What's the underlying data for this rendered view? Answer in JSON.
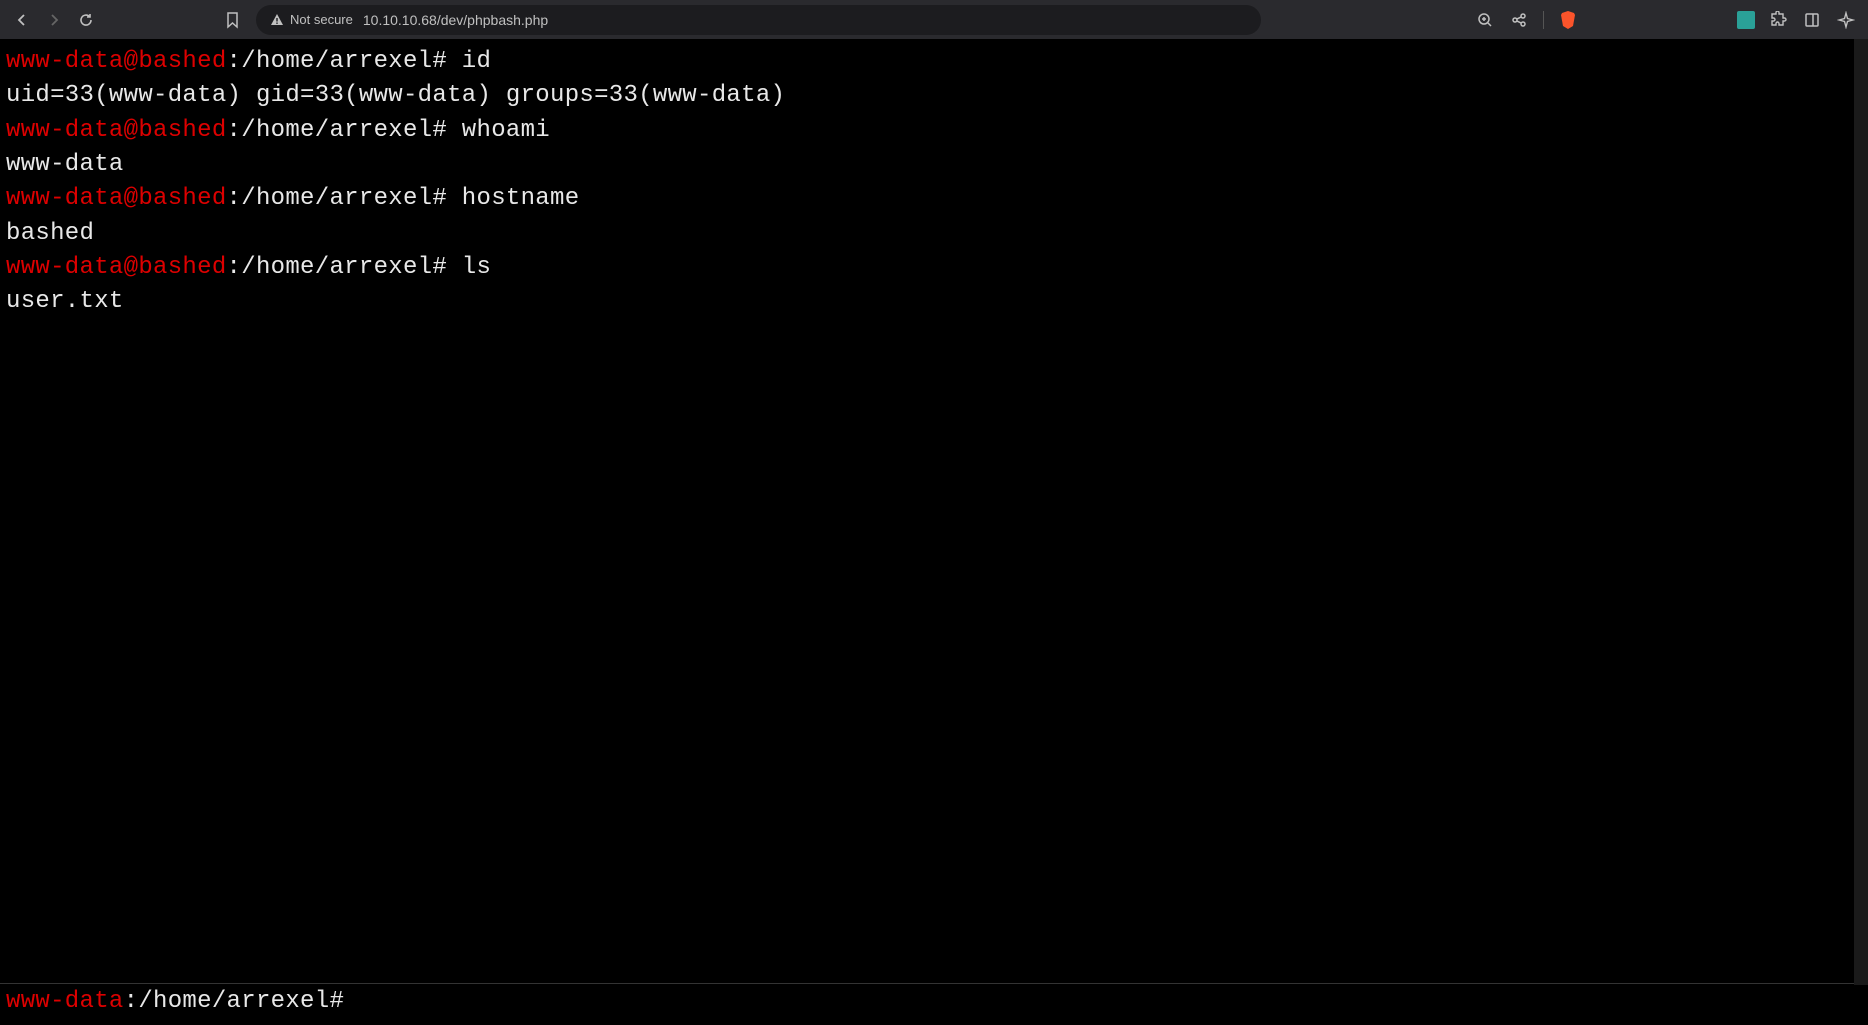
{
  "browser": {
    "security_label": "Not secure",
    "url": "10.10.10.68/dev/phpbash.php"
  },
  "terminal": {
    "history": [
      {
        "user_host": "www-data@bashed",
        "path": ":/home/arrexel#",
        "command": " id",
        "output": "uid=33(www-data) gid=33(www-data) groups=33(www-data)"
      },
      {
        "user_host": "www-data@bashed",
        "path": ":/home/arrexel#",
        "command": " whoami",
        "output": "www-data"
      },
      {
        "user_host": "www-data@bashed",
        "path": ":/home/arrexel#",
        "command": " hostname",
        "output": "bashed"
      },
      {
        "user_host": "www-data@bashed",
        "path": ":/home/arrexel#",
        "command": " ls",
        "output": "user.txt"
      }
    ]
  },
  "prompt": {
    "user": "www-data",
    "path": ":/home/arrexel#"
  }
}
